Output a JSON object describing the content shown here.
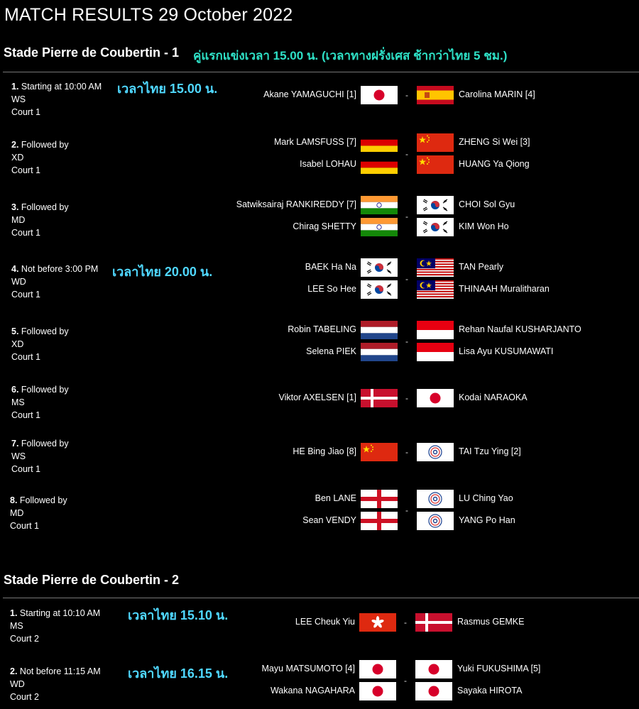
{
  "page_title": "MATCH RESULTS 29 October 2022",
  "venues": [
    {
      "name": "Stade Pierre de Coubertin - 1",
      "note": "คู่แรกแข่งเวลา 15.00 น. (เวลาทางฝรั่งเศส ช้ากว่าไทย 5 ชม.)",
      "matches": [
        {
          "num": "1.",
          "time": "Starting at 10:00 AM",
          "event": "WS",
          "court": "Court 1",
          "thai_time": "เวลาไทย 15.00 น.",
          "left": [
            {
              "name": "Akane YAMAGUCHI [1]",
              "flag": "japan"
            }
          ],
          "right": [
            {
              "name": "Carolina MARIN [4]",
              "flag": "spain"
            }
          ]
        },
        {
          "num": "2.",
          "time": "Followed by",
          "event": "XD",
          "court": "Court 1",
          "thai_time": "",
          "left": [
            {
              "name": "Mark LAMSFUSS [7]",
              "flag": "germany"
            },
            {
              "name": "Isabel LOHAU",
              "flag": "germany"
            }
          ],
          "right": [
            {
              "name": "ZHENG Si Wei [3]",
              "flag": "china"
            },
            {
              "name": "HUANG Ya Qiong",
              "flag": "china"
            }
          ]
        },
        {
          "num": "3.",
          "time": "Followed by",
          "event": "MD",
          "court": "Court 1",
          "thai_time": "",
          "left": [
            {
              "name": "Satwiksairaj RANKIREDDY [7]",
              "flag": "india"
            },
            {
              "name": "Chirag SHETTY",
              "flag": "india"
            }
          ],
          "right": [
            {
              "name": "CHOI Sol Gyu",
              "flag": "korea"
            },
            {
              "name": "KIM Won Ho",
              "flag": "korea"
            }
          ]
        },
        {
          "num": "4.",
          "time": "Not before 3:00 PM",
          "event": "WD",
          "court": "Court 1",
          "thai_time": "เวลาไทย 20.00 น.",
          "left": [
            {
              "name": "BAEK Ha Na",
              "flag": "korea"
            },
            {
              "name": "LEE So Hee",
              "flag": "korea"
            }
          ],
          "right": [
            {
              "name": "TAN Pearly",
              "flag": "malaysia"
            },
            {
              "name": "THINAAH Muralitharan",
              "flag": "malaysia"
            }
          ]
        },
        {
          "num": "5.",
          "time": "Followed by",
          "event": "XD",
          "court": "Court 1",
          "thai_time": "",
          "left": [
            {
              "name": "Robin TABELING",
              "flag": "netherlands"
            },
            {
              "name": "Selena PIEK",
              "flag": "netherlands"
            }
          ],
          "right": [
            {
              "name": "Rehan Naufal KUSHARJANTO",
              "flag": "indonesia"
            },
            {
              "name": "Lisa Ayu KUSUMAWATI",
              "flag": "indonesia"
            }
          ]
        },
        {
          "num": "6.",
          "time": "Followed by",
          "event": "MS",
          "court": "Court 1",
          "thai_time": "",
          "left": [
            {
              "name": "Viktor AXELSEN [1]",
              "flag": "denmark"
            }
          ],
          "right": [
            {
              "name": "Kodai NARAOKA",
              "flag": "japan"
            }
          ]
        },
        {
          "num": "7.",
          "time": "Followed by",
          "event": "WS",
          "court": "Court 1",
          "thai_time": "",
          "left": [
            {
              "name": "HE Bing Jiao [8]",
              "flag": "china"
            }
          ],
          "right": [
            {
              "name": "TAI Tzu Ying [2]",
              "flag": "taipei"
            }
          ]
        },
        {
          "num": "8.",
          "time": "Followed by",
          "event": "MD",
          "court": "Court 1",
          "thai_time": "",
          "left": [
            {
              "name": "Ben LANE",
              "flag": "england"
            },
            {
              "name": "Sean VENDY",
              "flag": "england"
            }
          ],
          "right": [
            {
              "name": "LU Ching Yao",
              "flag": "taipei"
            },
            {
              "name": "YANG Po Han",
              "flag": "taipei"
            }
          ]
        }
      ]
    },
    {
      "name": "Stade Pierre de Coubertin - 2",
      "note": "",
      "matches": [
        {
          "num": "1.",
          "time": "Starting at 10:10 AM",
          "event": "MS",
          "court": "Court 2",
          "thai_time": "เวลาไทย 15.10 น.",
          "left": [
            {
              "name": "LEE Cheuk Yiu",
              "flag": "hongkong"
            }
          ],
          "right": [
            {
              "name": "Rasmus GEMKE",
              "flag": "denmark"
            }
          ]
        },
        {
          "num": "2.",
          "time": "Not before 11:15 AM",
          "event": "WD",
          "court": "Court 2",
          "thai_time": "เวลาไทย 16.15 น.",
          "left": [
            {
              "name": "Mayu MATSUMOTO [4]",
              "flag": "japan"
            },
            {
              "name": "Wakana NAGAHARA",
              "flag": "japan"
            }
          ],
          "right": [
            {
              "name": "Yuki FUKUSHIMA [5]",
              "flag": "japan"
            },
            {
              "name": "Sayaka HIROTA",
              "flag": "japan"
            }
          ]
        }
      ]
    }
  ],
  "separator": "-"
}
